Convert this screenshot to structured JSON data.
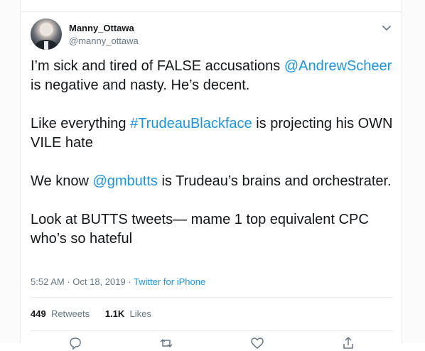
{
  "tweet": {
    "author_name": "Manny_Ottawa",
    "author_handle": "@manny_ottawa",
    "p1_pre": "I’m sick and tired of FALSE accusations ",
    "p1_mention": "@AndrewScheer",
    "p1_post": " is negative and nasty. He’s decent.",
    "p2_pre": "Like everything ",
    "p2_hashtag": "#TrudeauBlackface",
    "p2_post": " is projecting his OWN VILE hate",
    "p3_pre": "We know ",
    "p3_mention": "@gmbutts",
    "p3_post": " is Trudeau’s brains and orchestrater.",
    "p4": "Look at BUTTS tweets— mame 1 top equivalent CPC who’s so hateful",
    "timestamp": "5:52 AM · Oct 18, 2019 · ",
    "source_app": "Twitter for iPhone",
    "retweets_count": "449",
    "retweets_label": "Retweets",
    "likes_count": "1.1K",
    "likes_label": "Likes"
  },
  "colors": {
    "link": "#1b95e0",
    "text": "#14171a",
    "muted": "#657786",
    "border": "#e6ecf0"
  },
  "icons": [
    "chevron-down-icon",
    "reply-icon",
    "retweet-icon",
    "like-icon",
    "share-icon"
  ]
}
